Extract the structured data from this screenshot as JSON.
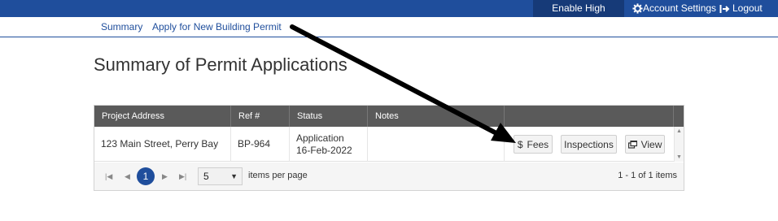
{
  "topbar": {
    "high_contrast": "Enable High Contrast",
    "account_settings": "Account Settings",
    "logout": "Logout",
    "accent": "#1f4e9c"
  },
  "nav": {
    "summary": "Summary",
    "apply": "Apply for New Building Permit"
  },
  "page": {
    "title": "Summary of Permit Applications"
  },
  "grid": {
    "columns": [
      "Project Address",
      "Ref #",
      "Status",
      "Notes",
      ""
    ],
    "rows": [
      {
        "address": "123 Main Street, Perry Bay",
        "ref": "BP-964",
        "status_line1": "Application",
        "status_line2": "16-Feb-2022",
        "notes": "",
        "actions": {
          "fees": "Fees",
          "inspections": "Inspections",
          "view": "View"
        }
      }
    ],
    "pager": {
      "current_page": "1",
      "page_size": "5",
      "items_per_page": "items per page",
      "info": "1 - 1 of 1 items"
    }
  },
  "icons": [
    "gear-icon",
    "logout-icon",
    "dollar-icon",
    "external-window-icon",
    "first-page-icon",
    "prev-page-icon",
    "next-page-icon",
    "last-page-icon",
    "dropdown-caret-icon"
  ]
}
